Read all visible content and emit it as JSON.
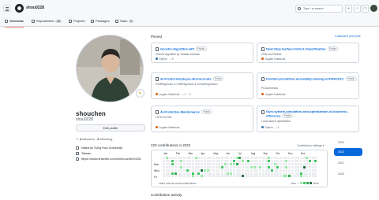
{
  "header": {
    "username": "shou0228",
    "search_placeholder": "Type / to search"
  },
  "tabs": [
    {
      "label": "Overview",
      "count": null,
      "active": true
    },
    {
      "label": "Repositories",
      "count": "10",
      "active": false
    },
    {
      "label": "Projects",
      "count": null,
      "active": false
    },
    {
      "label": "Packages",
      "count": null,
      "active": false
    },
    {
      "label": "Stars",
      "count": "0",
      "active": false
    }
  ],
  "profile": {
    "name": "shouchen",
    "login": "shou0228",
    "edit_label": "Edit profile",
    "followers_count": "4",
    "followers_label": "followers",
    "following_count": "6",
    "following_label": "following",
    "organization": "National Tsing Hua University",
    "location": "Taiwan",
    "link": "https://www.linkedin.com/in/shouchen0228"
  },
  "pinned": {
    "title": "Pinned",
    "customize_label": "Customize your pins",
    "cards": [
      {
        "name": "Genetic-Algorithm-API",
        "visibility": "Public",
        "desc": "Genetic Algorithm by Tarakan Katonaz",
        "language": "Python",
        "lang_color": "#3572a5",
        "stars": "3",
        "forks": ""
      },
      {
        "name": "Neat-Step-Surface-Defect-Classification",
        "visibility": "Public",
        "desc": "CNN and ResNet",
        "language": "Jupyter Notebook",
        "lang_color": "#da5b0b",
        "stars": "",
        "forks": ""
      },
      {
        "name": "AI-Predict-Employee-Burnout-rate",
        "visibility": "Public",
        "desc": "SVMRegressor & XGBRegressor & LinearRegression",
        "language": "Jupyter Notebook",
        "lang_color": "#da5b0b",
        "stars": "1",
        "forks": "1"
      },
      {
        "name": "Position-prediction-and-ability-ranking-of-FIFA2022-",
        "visibility": "Public",
        "desc": "PCA&Kmeans",
        "language": "Jupyter Notebook",
        "lang_color": "#da5b0b",
        "stars": "",
        "forks": ""
      },
      {
        "name": "AI-Predictive-Maintenance",
        "visibility": "Public",
        "desc": "LSTM for RUL",
        "language": "Jupyter Notebook",
        "lang_color": "#da5b0b",
        "stars": "",
        "forks": ""
      },
      {
        "name": "Gym-system-simulation-and-optimization-of-business-efficiency",
        "visibility": "Public",
        "desc": "Local search optimization",
        "language": "Python",
        "lang_color": "#3572a5",
        "stars": "1",
        "forks": ""
      }
    ]
  },
  "contributions": {
    "title": "220 contributions in 2022",
    "settings_label": "Contribution settings",
    "months": [
      "Jan",
      "Feb",
      "Mar",
      "Apr",
      "May",
      "Jun",
      "Jul",
      "Aug",
      "Sep",
      "Oct",
      "Nov",
      "Dec"
    ],
    "day_labels": [
      "Mon",
      "Wed",
      "Fri"
    ],
    "learn_label": "Learn how we count contributions",
    "less_label": "Less",
    "more_label": "More",
    "colors": [
      "#ebedf0",
      "#9be9a8",
      "#40c463",
      "#30a14e",
      "#216e39"
    ]
  },
  "years": [
    {
      "label": "2023",
      "selected": false
    },
    {
      "label": "2022",
      "selected": true
    },
    {
      "label": "2021",
      "selected": false
    },
    {
      "label": "2020",
      "selected": false
    }
  ],
  "activity_title": "Contribution activity",
  "icons": {
    "logo": "github-logo-icon",
    "search": "search-icon",
    "plus": "plus-icon",
    "issues": "issues-icon",
    "pulls": "pull-request-icon",
    "inbox": "inbox-icon"
  }
}
